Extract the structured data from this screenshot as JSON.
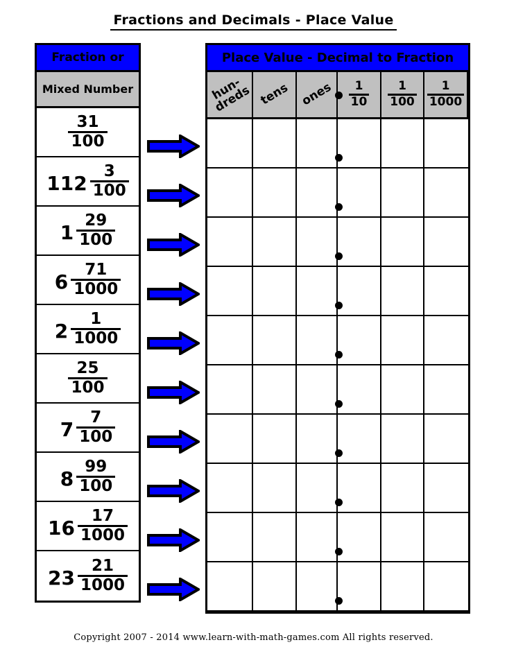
{
  "title": "Fractions and Decimals - Place Value",
  "colors": {
    "header_blue": "#0000FF",
    "header_gray": "#C0C0C0",
    "arrow_fill": "#0000FF",
    "arrow_outline": "#000000",
    "grid_line": "#000000"
  },
  "left_table": {
    "header_line1": "Fraction or",
    "header_line2": "Mixed Number",
    "rows": [
      {
        "whole": "",
        "numerator": "31",
        "denominator": "100"
      },
      {
        "whole": "112",
        "numerator": "3",
        "denominator": "100"
      },
      {
        "whole": "1",
        "numerator": "29",
        "denominator": "100"
      },
      {
        "whole": "6",
        "numerator": "71",
        "denominator": "1000"
      },
      {
        "whole": "2",
        "numerator": "1",
        "denominator": "1000"
      },
      {
        "whole": "",
        "numerator": "25",
        "denominator": "100"
      },
      {
        "whole": "7",
        "numerator": "7",
        "denominator": "100"
      },
      {
        "whole": "8",
        "numerator": "99",
        "denominator": "100"
      },
      {
        "whole": "16",
        "numerator": "17",
        "denominator": "1000"
      },
      {
        "whole": "23",
        "numerator": "21",
        "denominator": "1000"
      }
    ]
  },
  "arrows": {
    "icon": "right-arrow-icon",
    "count": 10
  },
  "right_table": {
    "header": "Place Value - Decimal to Fraction",
    "columns": [
      {
        "type": "word",
        "label": "hun-",
        "label2": "dreds",
        "rotated": true
      },
      {
        "type": "word",
        "label": "tens",
        "rotated": true
      },
      {
        "type": "word",
        "label": "ones",
        "rotated": true
      },
      {
        "type": "fraction",
        "numerator": "1",
        "denominator": "10"
      },
      {
        "type": "fraction",
        "numerator": "1",
        "denominator": "100"
      },
      {
        "type": "fraction",
        "numerator": "1",
        "denominator": "1000"
      }
    ],
    "decimal_point": "•",
    "answer_rows": 10
  },
  "footer": "Copyright   2007 - 2014   www.learn-with-math-games.com   All rights reserved."
}
